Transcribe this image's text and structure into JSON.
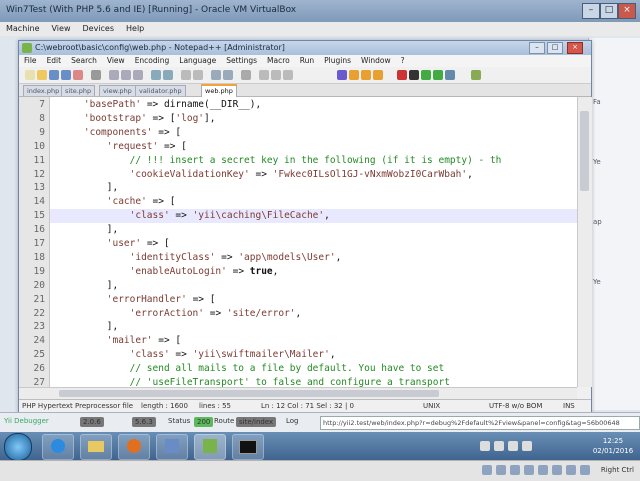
{
  "vbox": {
    "title": "Win7Test (With PHP 5.6 and IE) [Running] - Oracle VM VirtualBox",
    "menu": [
      "Machine",
      "View",
      "Devices",
      "Help"
    ],
    "host_key": "Right Ctrl"
  },
  "npp": {
    "title": "C:\\webroot\\basic\\config\\web.php - Notepad++ [Administrator]",
    "menu": [
      "File",
      "Edit",
      "Search",
      "View",
      "Encoding",
      "Language",
      "Settings",
      "Macro",
      "Run",
      "Plugins",
      "Window",
      "?"
    ],
    "tabs": [
      "index.php",
      "site.php",
      "view.php",
      "validator.php",
      "web.php"
    ],
    "active_tab": "web.php",
    "lines": [
      {
        "n": "7",
        "code": "    'basePath' => dirname(__DIR__),"
      },
      {
        "n": "8",
        "code": "    'bootstrap' => ['log'],"
      },
      {
        "n": "9",
        "code": "    'components' => ["
      },
      {
        "n": "10",
        "code": "        'request' => ["
      },
      {
        "n": "11",
        "code": "            // !!! insert a secret key in the following (if it is empty) - th"
      },
      {
        "n": "12",
        "code": "            'cookieValidationKey' => 'Fwkec0ILsOl1GJ-vNxmWobzI0CarWbah',"
      },
      {
        "n": "13",
        "code": "        ],"
      },
      {
        "n": "14",
        "code": "        'cache' => ["
      },
      {
        "n": "15",
        "code": "            'class' => 'yii\\caching\\FileCache',"
      },
      {
        "n": "16",
        "code": "        ],"
      },
      {
        "n": "17",
        "code": "        'user' => ["
      },
      {
        "n": "18",
        "code": "            'identityClass' => 'app\\models\\User',"
      },
      {
        "n": "19",
        "code": "            'enableAutoLogin' => true,"
      },
      {
        "n": "20",
        "code": "        ],"
      },
      {
        "n": "21",
        "code": "        'errorHandler' => ["
      },
      {
        "n": "22",
        "code": "            'errorAction' => 'site/error',"
      },
      {
        "n": "23",
        "code": "        ],"
      },
      {
        "n": "24",
        "code": "        'mailer' => ["
      },
      {
        "n": "25",
        "code": "            'class' => 'yii\\swiftmailer\\Mailer',"
      },
      {
        "n": "26",
        "code": "            // send all mails to a file by default. You have to set"
      },
      {
        "n": "27",
        "code": "            // 'useFileTransport' to false and configure a transport"
      }
    ],
    "status": {
      "lang": "PHP Hypertext Preprocessor file",
      "length": "length : 1600",
      "lines": "lines : 55",
      "pos": "Ln : 12    Col : 71    Sel : 32 | 0",
      "eol": "UNIX",
      "enc": "UTF-8 w/o BOM",
      "mode": "INS"
    }
  },
  "debugbar": {
    "label": "Yii Debugger",
    "yii_version": "2.0.6",
    "php_version": "5.6.3",
    "status_label": "Status",
    "status_code": "200",
    "route_label": "Route",
    "route": "site/index",
    "log_label": "Log",
    "url": "http://yii2.test/web/index.php?r=debug%2Fdefault%2Fview&panel=config&tag=56b00648"
  },
  "ie_side": [
    "Fa",
    "Ye",
    "ap",
    "Ye"
  ],
  "taskbar": {
    "time": "12:25",
    "date": "02/01/2016"
  }
}
